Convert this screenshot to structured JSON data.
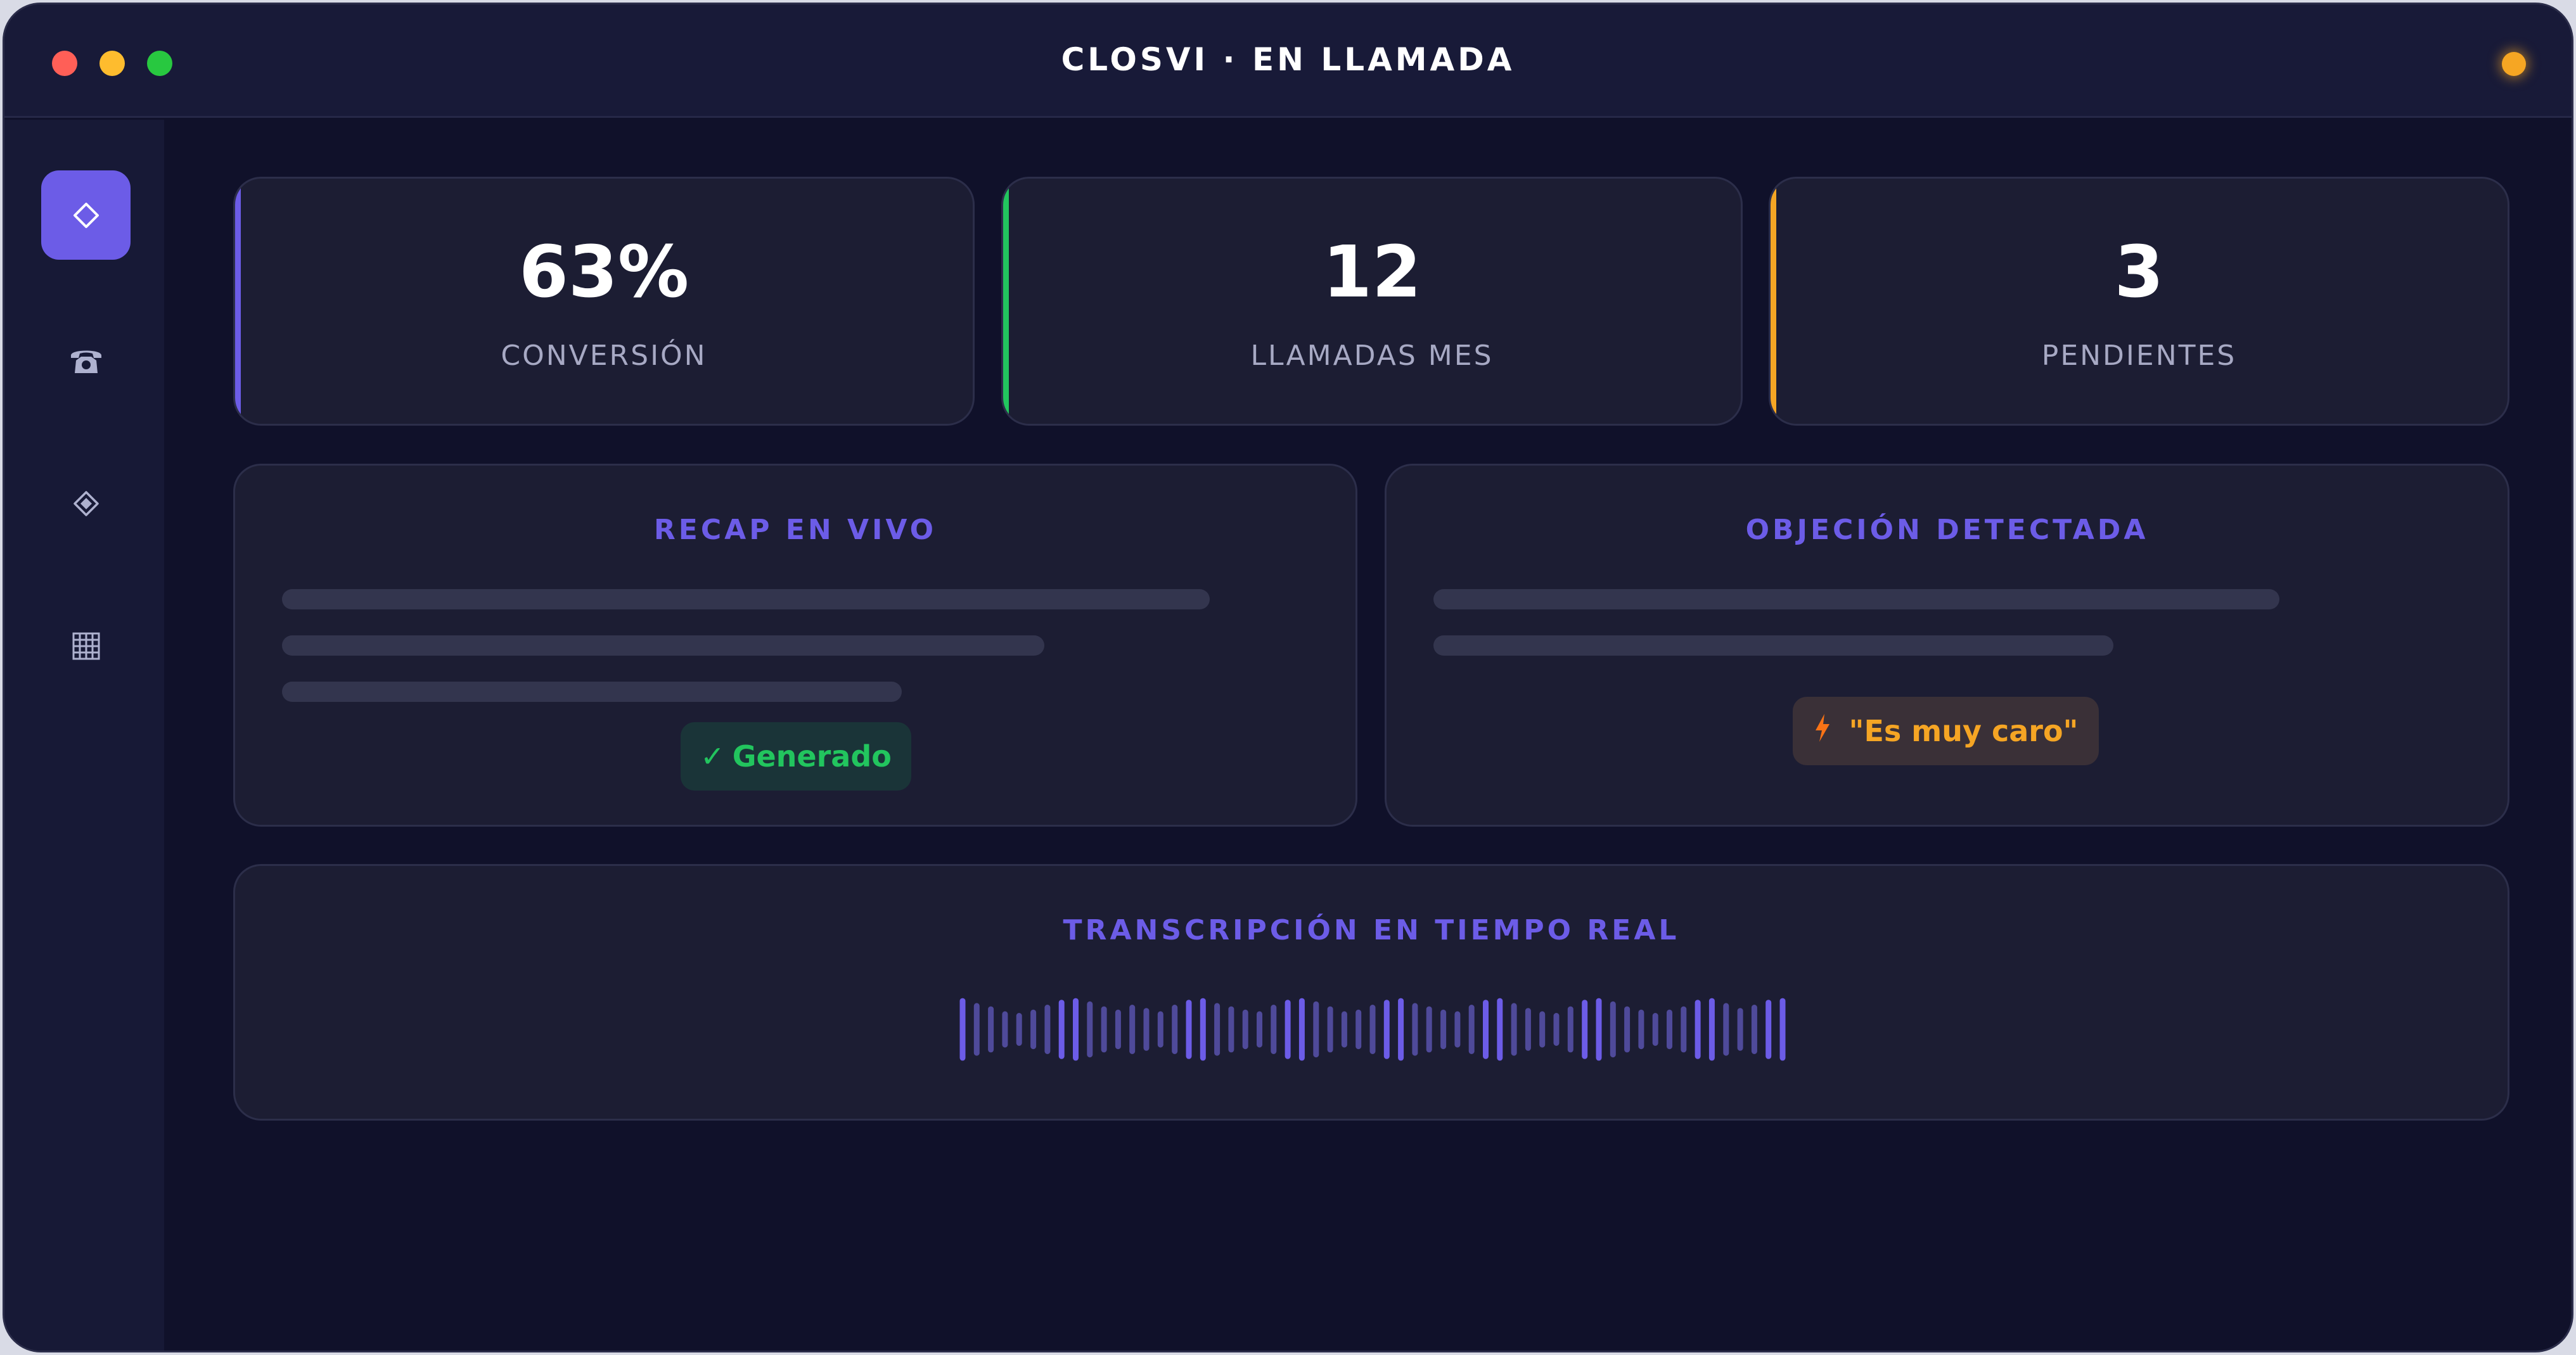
{
  "window": {
    "title": "CLOSVI · EN LLAMADA"
  },
  "sidebar": {
    "items": [
      {
        "name": "diamond",
        "active": true
      },
      {
        "name": "phone",
        "active": false
      },
      {
        "name": "diamond-inset",
        "active": false
      },
      {
        "name": "grid",
        "active": false
      }
    ]
  },
  "stats": [
    {
      "value": "63%",
      "label": "CONVERSIÓN",
      "accent": "#6c5ce7"
    },
    {
      "value": "12",
      "label": "LLAMADAS MES",
      "accent": "#22c55e"
    },
    {
      "value": "3",
      "label": "PENDIENTES",
      "accent": "#f5a524"
    }
  ],
  "recap": {
    "title": "RECAP EN VIVO",
    "badge_check": "✓",
    "badge": "Generado"
  },
  "objection": {
    "title": "OBJECIÓN DETECTADA",
    "badge": "\"Es muy caro\""
  },
  "transcription": {
    "title": "TRANSCRIPCIÓN EN TIEMPO REAL",
    "waveform_levels": [
      0.95,
      0.8,
      0.7,
      0.55,
      0.5,
      0.6,
      0.75,
      0.9,
      0.95,
      0.85,
      0.7,
      0.6,
      0.75,
      0.65,
      0.55,
      0.75,
      0.9,
      0.95,
      0.8,
      0.7,
      0.6,
      0.55,
      0.75,
      0.9,
      0.95,
      0.85,
      0.7,
      0.55,
      0.6,
      0.75,
      0.9,
      0.95,
      0.8,
      0.7,
      0.6,
      0.55,
      0.75,
      0.9,
      0.95,
      0.8,
      0.65,
      0.55,
      0.5,
      0.7,
      0.9,
      0.95,
      0.85,
      0.7,
      0.6,
      0.5,
      0.6,
      0.7,
      0.9,
      0.95,
      0.8,
      0.65,
      0.75,
      0.9,
      0.95
    ],
    "bar_colors": {
      "bright": "#6c5ce7",
      "dim": "#4f4a9a"
    }
  },
  "colors": {
    "accent": "#6c5ce7",
    "success": "#22c55e",
    "warning": "#f5a524",
    "status_dot": "#f6a623"
  }
}
